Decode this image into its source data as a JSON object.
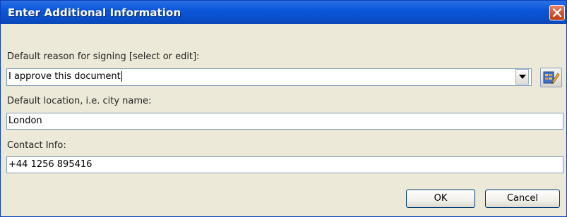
{
  "dialog": {
    "title": "Enter Additional Information"
  },
  "fields": {
    "reason_label": "Default reason for signing [select or edit]:",
    "reason_value": "I approve this document",
    "location_label": "Default location, i.e. city name:",
    "location_value": "London",
    "contact_label": "Contact Info:",
    "contact_value": "+44 1256 895416"
  },
  "buttons": {
    "ok": "OK",
    "cancel": "Cancel"
  },
  "icons": {
    "close": "close-icon",
    "dropdown": "chevron-down-icon",
    "edit": "edit-list-icon"
  },
  "colors": {
    "titlebar": "#0b57d9",
    "close_button": "#d6512c",
    "dialog_background": "#ece9d8",
    "field_border": "#7f9db9"
  }
}
